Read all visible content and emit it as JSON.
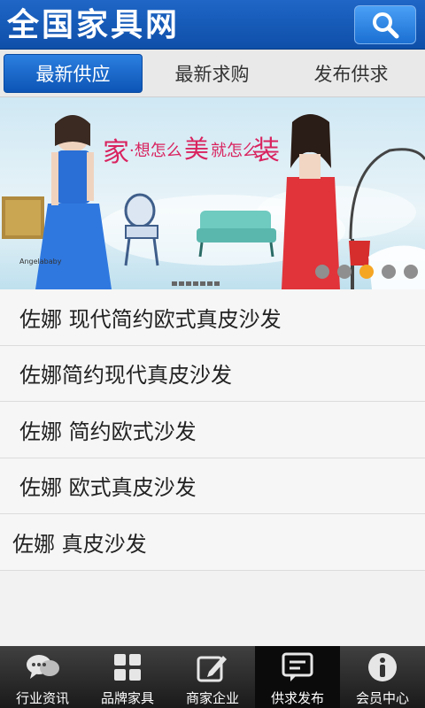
{
  "header": {
    "title": "全国家具网",
    "search_icon": "search-icon"
  },
  "tabs": [
    {
      "label": "最新供应",
      "active": true
    },
    {
      "label": "最新求购",
      "active": false
    },
    {
      "label": "发布供求",
      "active": false
    }
  ],
  "banner": {
    "headline_1": "家",
    "headline_2": "·想怎么",
    "headline_3": "美",
    "headline_4": "就怎么",
    "headline_5": "装",
    "watermark": "Angelababy",
    "dots_count": 5,
    "active_dot": 3,
    "colors": {
      "accent": "#f5a623",
      "headline": "#d9235f"
    }
  },
  "list": {
    "items": [
      "佐娜 现代简约欧式真皮沙发",
      "佐娜简约现代真皮沙发",
      "佐娜 简约欧式沙发",
      "佐娜 欧式真皮沙发",
      "佐娜 真皮沙发"
    ]
  },
  "bottom_nav": {
    "items": [
      {
        "label": "行业资讯",
        "icon": "chat-bubbles-icon",
        "active": false
      },
      {
        "label": "品牌家具",
        "icon": "grid-icon",
        "active": false
      },
      {
        "label": "商家企业",
        "icon": "edit-icon",
        "active": false
      },
      {
        "label": "供求发布",
        "icon": "message-icon",
        "active": true
      },
      {
        "label": "会员中心",
        "icon": "info-icon",
        "active": false
      }
    ]
  }
}
